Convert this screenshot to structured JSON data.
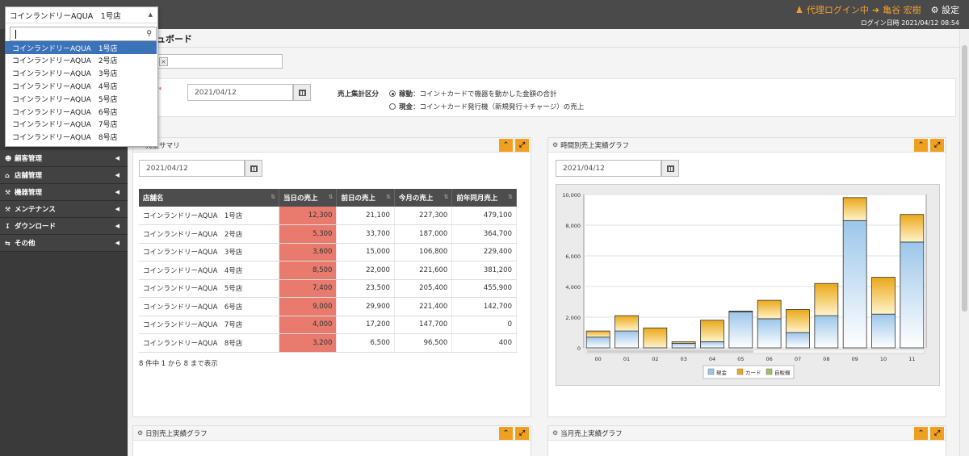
{
  "header": {
    "proxy_label": "代理ログイン中",
    "user_name": "亀谷 宏樹",
    "settings_label": "設定",
    "login_time": "ログイン日時 2021/04/12 08:54"
  },
  "page": {
    "title": "ュボード",
    "required_mark": "*"
  },
  "sidebar": {
    "items": [
      {
        "icon": "users-icon",
        "label": "顧客管理"
      },
      {
        "icon": "home-icon",
        "label": "店舗管理"
      },
      {
        "icon": "wrench-icon",
        "label": "機器管理"
      },
      {
        "icon": "tools-icon",
        "label": "メンテナンス"
      },
      {
        "icon": "download-icon",
        "label": "ダウンロード"
      },
      {
        "icon": "shuffle-icon",
        "label": "その他"
      }
    ]
  },
  "dropdown": {
    "selected": "コインランドリーAQUA　1号店",
    "search_value": "",
    "options": [
      "コインランドリーAQUA　1号店",
      "コインランドリーAQUA　2号店",
      "コインランドリーAQUA　3号店",
      "コインランドリーAQUA　4号店",
      "コインランドリーAQUA　5号店",
      "コインランドリーAQUA　6号店",
      "コインランドリーAQUA　7号店",
      "コインランドリーAQUA　8号店"
    ],
    "active_index": 0
  },
  "filters": {
    "date": "2021/04/12",
    "aggregation_label": "売上集計区分",
    "options": [
      {
        "checked": true,
        "prefix": "稼動",
        "text": "：コイン＋カードで機器を動かした金額の合計"
      },
      {
        "checked": false,
        "prefix": "現金",
        "text": "：コイン＋カード発行機（新規発行＋チャージ）の売上"
      }
    ]
  },
  "summary_panel": {
    "title": "売上サマリ",
    "date": "2021/04/12",
    "columns": [
      "店舗名",
      "当日の売上",
      "前日の売上",
      "今月の売上",
      "前年同月売上"
    ],
    "rows": [
      [
        "コインランドリーAQUA　1号店",
        "12,300",
        "21,100",
        "227,300",
        "479,100"
      ],
      [
        "コインランドリーAQUA　2号店",
        "5,300",
        "33,700",
        "187,000",
        "364,700"
      ],
      [
        "コインランドリーAQUA　3号店",
        "3,600",
        "15,000",
        "106,800",
        "229,400"
      ],
      [
        "コインランドリーAQUA　4号店",
        "8,500",
        "22,000",
        "221,600",
        "381,200"
      ],
      [
        "コインランドリーAQUA　5号店",
        "7,400",
        "23,500",
        "205,400",
        "455,900"
      ],
      [
        "コインランドリーAQUA　6号店",
        "9,000",
        "29,900",
        "221,400",
        "142,700"
      ],
      [
        "コインランドリーAQUA　7号店",
        "4,000",
        "17,200",
        "147,700",
        "0"
      ],
      [
        "コインランドリーAQUA　8号店",
        "3,200",
        "6,500",
        "96,500",
        "400"
      ]
    ],
    "info": "8 件中 1 から 8 まで表示"
  },
  "hourly_panel": {
    "title": "時間別売上実績グラフ",
    "date": "2021/04/12"
  },
  "daily_panel": {
    "title": "日別売上実績グラフ"
  },
  "monthly_panel": {
    "title": "当月売上実績グラフ"
  },
  "colors": {
    "accent": "#f0a020",
    "highlight": "#e87a6e",
    "cash": "#bcd8f0",
    "card": "#f0b830",
    "vending": "#a0c060"
  },
  "chart_data": {
    "type": "bar",
    "stacked": true,
    "categories": [
      "00",
      "01",
      "02",
      "03",
      "04",
      "05",
      "06",
      "07",
      "08",
      "09",
      "10",
      "11"
    ],
    "series": [
      {
        "name": "現金",
        "values": [
          700,
          1100,
          0,
          300,
          400,
          2350,
          1900,
          1000,
          2100,
          8300,
          2200,
          6900
        ]
      },
      {
        "name": "カード",
        "values": [
          400,
          1000,
          1300,
          100,
          1400,
          50,
          1200,
          1500,
          2100,
          1500,
          2400,
          1800
        ]
      },
      {
        "name": "自販機",
        "values": [
          0,
          0,
          0,
          0,
          0,
          0,
          0,
          0,
          0,
          0,
          0,
          0
        ]
      }
    ],
    "yticks": [
      "0",
      "2,000",
      "4,000",
      "6,000",
      "8,000",
      "10,000"
    ],
    "ylim": [
      0,
      10000
    ],
    "grid": true,
    "legend": "bottom-center"
  }
}
